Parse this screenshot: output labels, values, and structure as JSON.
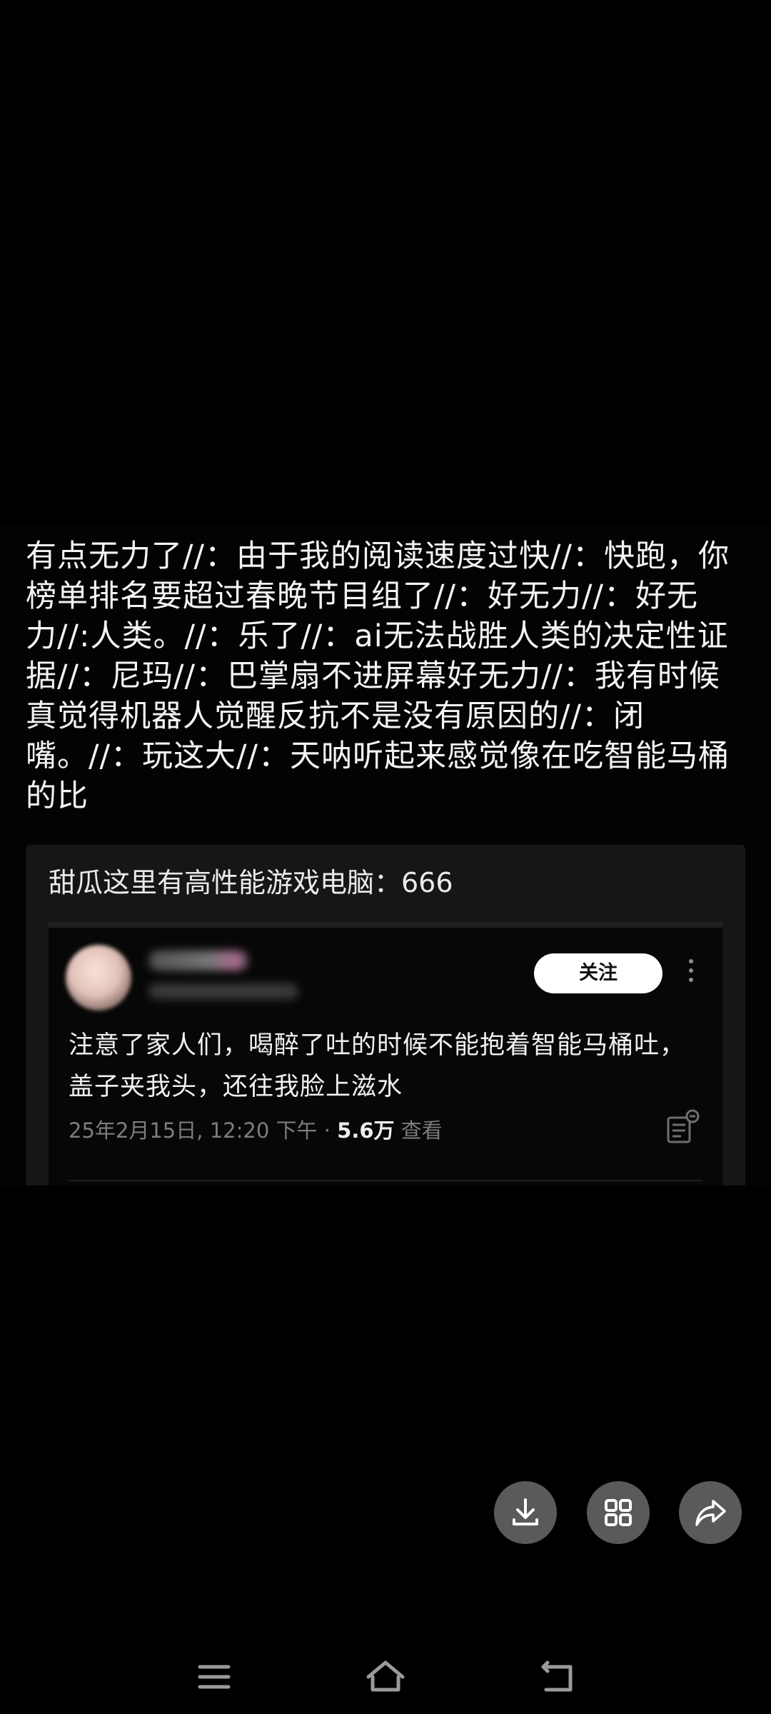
{
  "post": {
    "repost_chain": "有点无力了//：由于我的阅读速度过快//：快跑，你榜单排名要超过春晚节目组了//：好无力//：好无力//:人类。//：乐了//：ai无法战胜人类的决定性证据//：尼玛//：巴掌扇不进屏幕好无力//：我有时候真觉得机器人觉醒反抗不是没有原因的//：闭嘴。//：玩这大//：天呐听起来感觉像在吃智能马桶的比",
    "quote_line": "甜瓜这里有高性能游戏电脑：666"
  },
  "tweet": {
    "follow_label": "关注",
    "text": "注意了家人们，喝醉了吐的时候不能抱着智能马桶吐，盖子夹我头，还往我脸上滋水",
    "timestamp": "25年2月15日, 12:20 下午 · ",
    "views": "5.6万",
    "views_suffix": " 查看"
  },
  "icons": {
    "avatar": "avatar-blurred",
    "more": "more-vertical-icon",
    "stats": "post-stats-icon",
    "download": "download-icon",
    "grid": "grid-icon",
    "share": "share-icon",
    "menu": "menu-icon",
    "home": "home-icon",
    "back": "back-icon"
  },
  "colors": {
    "background": "#000000",
    "action_button": "#5a5a5a",
    "follow_button": "#ffffff",
    "meta_text": "#7d7d7d"
  }
}
